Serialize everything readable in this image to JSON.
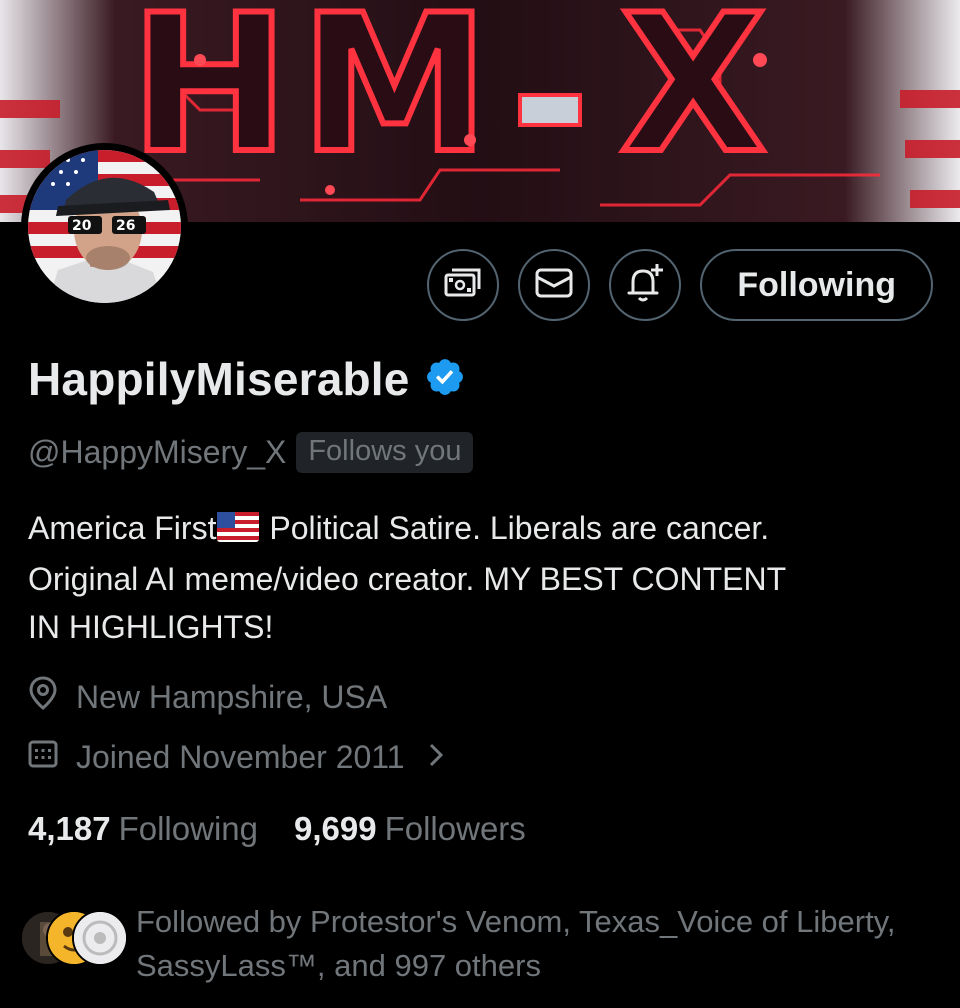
{
  "banner": {
    "logo_text": "HM X"
  },
  "actions": {
    "tip_icon": "money-icon",
    "message_icon": "envelope-icon",
    "notify_icon": "bell-plus-icon",
    "follow_label": "Following"
  },
  "profile": {
    "display_name": "HappilyMiserable",
    "verified": true,
    "handle": "@HappyMisery_X",
    "follows_you": "Follows you",
    "bio_line1_a": "America First",
    "bio_line1_b": " Political Satire.  Liberals are cancer.",
    "bio_line2": "Original AI meme/video creator.  MY BEST CONTENT",
    "bio_line3": "IN HIGHLIGHTS!",
    "location": "New Hampshire, USA",
    "joined": "Joined November 2011"
  },
  "stats": {
    "following_count": "4,187",
    "following_label": "Following",
    "followers_count": "9,699",
    "followers_label": "Followers"
  },
  "followed_by": {
    "text": "Followed by Protestor's Venom, Texas_Voice of Liberty, SassyLass™, and 997 others"
  },
  "colors": {
    "background": "#000000",
    "text_primary": "#e7e9ea",
    "text_secondary": "#71767b",
    "border": "#536471",
    "verified_blue": "#1d9bf0",
    "badge_bg": "#202327"
  }
}
